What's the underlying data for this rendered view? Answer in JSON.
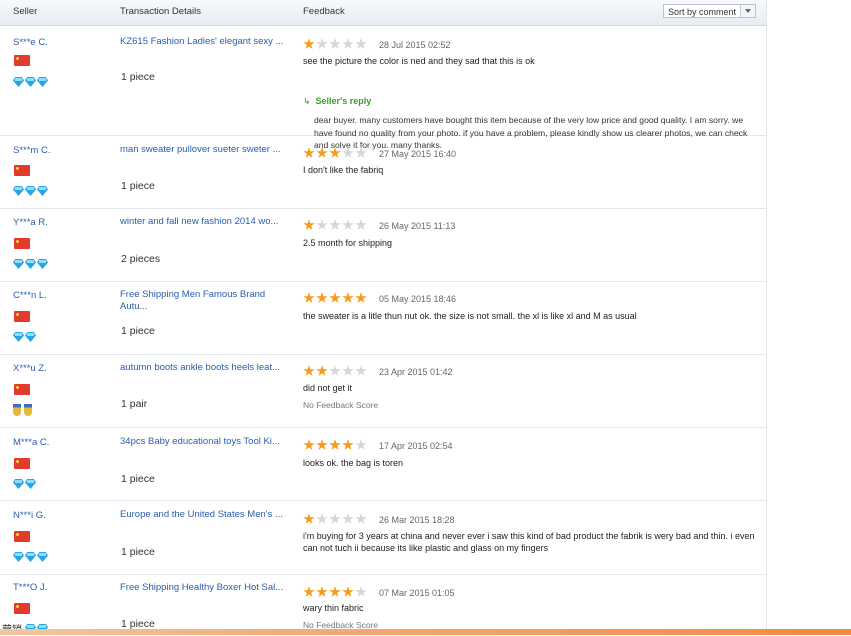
{
  "header": {
    "seller": "Seller",
    "transaction": "Transaction Details",
    "feedback": "Feedback",
    "sort": "Sort by comment"
  },
  "rows": [
    {
      "seller": "S***e C.",
      "product": "KZ615 Fashion Ladies' elegant sexy ...",
      "qty": "1 piece",
      "rating": 1,
      "date": "28 Jul 2015 02:52",
      "comment": "see the picture the color is ned and they sad that this is ok",
      "badge": "diamond",
      "badge_count": 3,
      "reply_label": "Seller's reply",
      "reply": "dear buyer. many customers have bought this item because of the very low price and good quality. I am sorry. we have found no quality from your photo. if you have a problem, please kindly show us clearer photos, we can check and solve it for you. many thanks."
    },
    {
      "seller": "S***m C.",
      "product": "man sweater pullover sueter sweter ...",
      "qty": "1 piece",
      "rating": 3,
      "date": "27 May 2015 16:40",
      "comment": "I don't like the fabriq",
      "badge": "diamond",
      "badge_count": 3
    },
    {
      "seller": "Y***a R.",
      "product": "winter and fall new fashion 2014 wo...",
      "qty": "2 pieces",
      "rating": 1,
      "date": "26 May 2015 11:13",
      "comment": "2.5 month for shipping",
      "badge": "diamond",
      "badge_count": 3
    },
    {
      "seller": "C***n L.",
      "product": "Free Shipping Men Famous Brand Autu...",
      "qty": "1 piece",
      "rating": 5,
      "date": "05 May 2015 18:46",
      "comment": "the sweater is a litle thun nut ok. the size is not small. the xl is like xl and M as usual",
      "badge": "diamond",
      "badge_count": 2
    },
    {
      "seller": "X***u Z.",
      "product": "autumn boots ankle boots heels leat...",
      "qty": "1 pair",
      "rating": 2,
      "date": "23 Apr 2015 01:42",
      "comment": "did not get it",
      "nofb": "No Feedback Score",
      "badge": "medal",
      "badge_count": 2
    },
    {
      "seller": "M***a C.",
      "product": "34pcs Baby educational toys Tool Ki...",
      "qty": "1 piece",
      "rating": 4,
      "date": "17 Apr 2015 02:54",
      "comment": "looks ok. the bag is toren",
      "badge": "diamond",
      "badge_count": 2
    },
    {
      "seller": "N***i G.",
      "product": "Europe and the United States Men's ...",
      "qty": "1 piece",
      "rating": 1,
      "date": "26 Mar 2015 18:28",
      "comment": "i'm buying for 3 years at china and never ever i saw this kind of bad product the fabrik is wery bad and thin. i even can not tuch ii because its like plastic and glass on my fingers",
      "badge": "diamond",
      "badge_count": 3
    },
    {
      "seller": "T***O J.",
      "product": "Free Shipping Healthy Boxer Hot Sal...",
      "qty": "1 piece",
      "rating": 4,
      "date": "07 Mar 2015 01:05",
      "comment": "wary thin fabric",
      "nofb": "No Feedback Score",
      "badge": "diamond",
      "badge_count": 3
    }
  ],
  "bottom_label": "营销",
  "colors": {
    "star_on": "#f59c1a",
    "star_off": "#d6d6d6",
    "link": "#2a5db0",
    "reply": "#3d9b2f"
  }
}
